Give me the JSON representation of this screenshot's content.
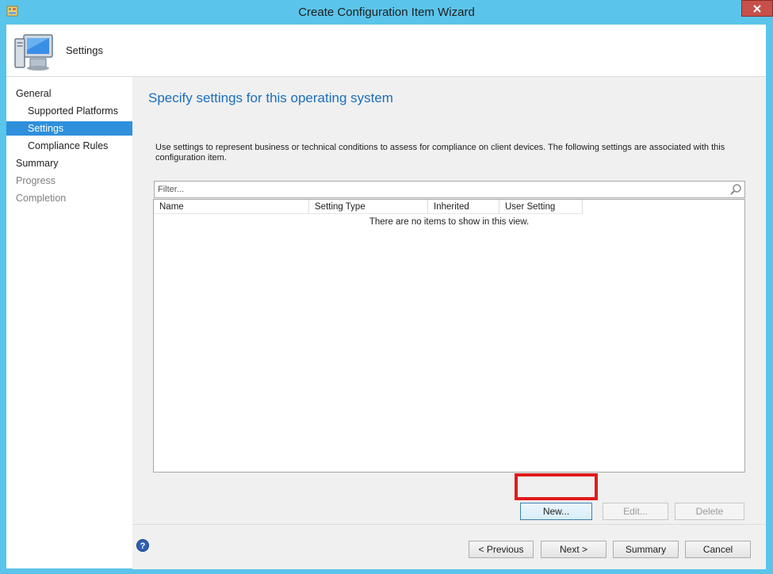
{
  "window": {
    "title": "Create Configuration Item Wizard"
  },
  "header": {
    "title": "Settings",
    "icon": "computer-monitor-icon"
  },
  "nav": {
    "items": [
      {
        "label": "General",
        "level": "top",
        "state": "normal"
      },
      {
        "label": "Supported Platforms",
        "level": "sub",
        "state": "normal"
      },
      {
        "label": "Settings",
        "level": "sub",
        "state": "selected"
      },
      {
        "label": "Compliance Rules",
        "level": "sub",
        "state": "normal"
      },
      {
        "label": "Summary",
        "level": "top",
        "state": "normal"
      },
      {
        "label": "Progress",
        "level": "top",
        "state": "disabled"
      },
      {
        "label": "Completion",
        "level": "top",
        "state": "disabled"
      }
    ]
  },
  "main": {
    "heading": "Specify settings for this operating system",
    "description": "Use settings to represent business or technical conditions to assess for compliance on client devices. The following settings are associated with this configuration item.",
    "filter_placeholder": "Filter...",
    "columns": [
      "Name",
      "Setting Type",
      "Inherited",
      "User Setting"
    ],
    "empty_text": "There are no items to show in this view.",
    "actions": {
      "new_label": "New...",
      "edit_label": "Edit...",
      "delete_label": "Delete"
    }
  },
  "footer": {
    "previous_label": "< Previous",
    "next_label": "Next >",
    "summary_label": "Summary",
    "cancel_label": "Cancel"
  },
  "colors": {
    "titlebar": "#5bc4ea",
    "selection": "#2f8fdb",
    "heading": "#1a6ebf",
    "highlight": "#e01b1b"
  }
}
